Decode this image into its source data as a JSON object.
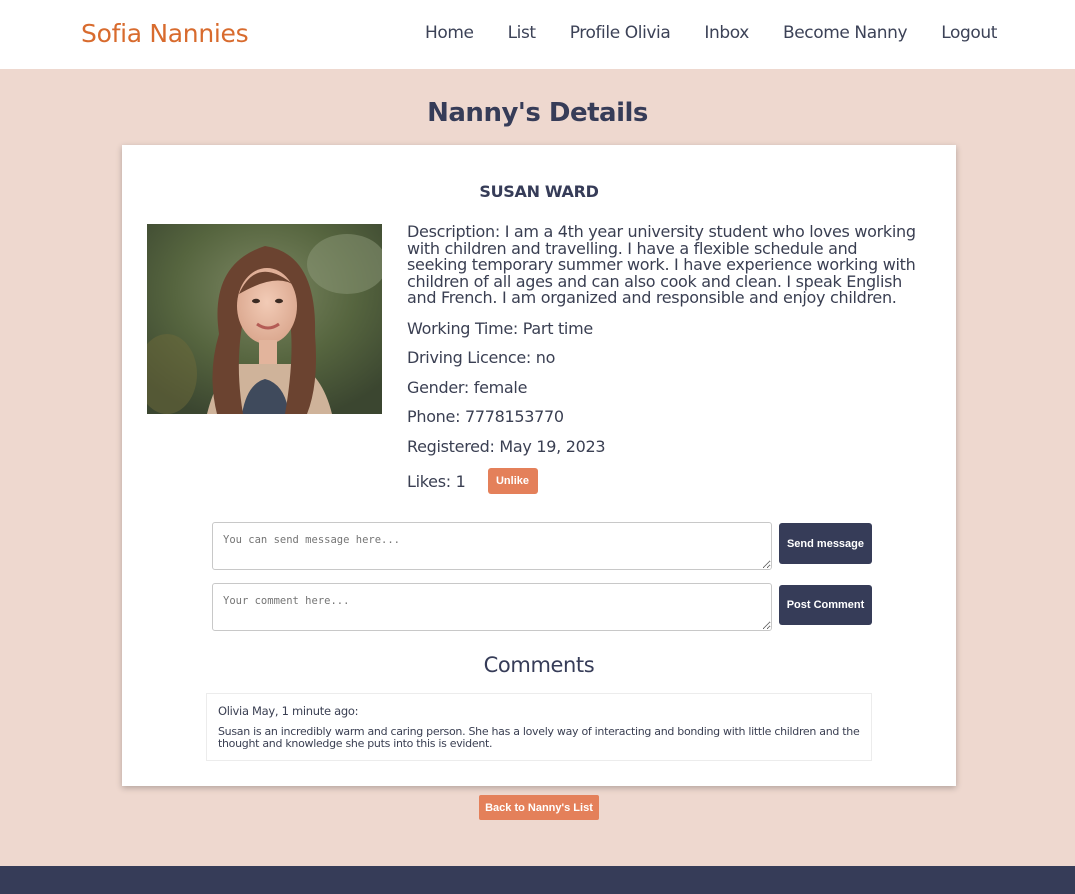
{
  "navbar": {
    "brand": "Sofia Nannies",
    "links": [
      "Home",
      "List",
      "Profile Olivia",
      "Inbox",
      "Become Nanny",
      "Logout"
    ]
  },
  "page": {
    "title": "Nanny's Details"
  },
  "nanny": {
    "name": "SUSAN WARD",
    "description": "Description: I am a 4th year university student who loves working with children and travelling. I have a flexible schedule and seeking temporary summer work. I have experience working with children of all ages and can also cook and clean. I speak English and French. I am organized and responsible and enjoy children.",
    "working_time": "Working Time: Part time",
    "driving_licence": "Driving Licence: no",
    "gender": "Gender: female",
    "phone": "Phone: 7778153770",
    "registered": "Registered: May 19, 2023",
    "likes": "Likes: 1",
    "unlike_label": "Unlike"
  },
  "message": {
    "placeholder": "You can send message here...",
    "button": "Send message"
  },
  "comment_form": {
    "placeholder": "Your comment here...",
    "button": "Post Comment"
  },
  "comments": {
    "heading": "Comments",
    "items": [
      {
        "meta": "Olivia May, 1 minute ago:",
        "text": "Susan is an incredibly warm and caring person. She has a lovely way of interacting and bonding with little children and the thought and knowledge she puts into this is evident."
      }
    ]
  },
  "back_button": "Back to Nanny's List",
  "colors": {
    "brand": "#d86b2e",
    "background": "#eed8cf",
    "dark": "#363c58",
    "accent": "#e4805a"
  }
}
